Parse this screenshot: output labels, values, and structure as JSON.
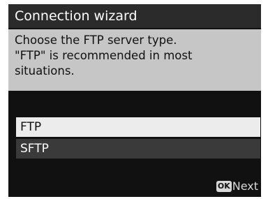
{
  "title": "Connection wizard",
  "instructions": [
    "Choose the FTP server type.",
    "\"FTP\" is recommended in most",
    "situations."
  ],
  "options": [
    {
      "label": "FTP",
      "selected": true
    },
    {
      "label": "SFTP",
      "selected": false
    }
  ],
  "footer": {
    "ok_icon_text": "OK",
    "action_label": "Next"
  },
  "colors": {
    "background": "#111111",
    "title_bar": "#2b2b2b",
    "instruction_panel": "#c6c6c6",
    "selected_option": "#ececec",
    "unselected_option": "#3a3a3a"
  },
  "icons": {
    "ok_button": "ok-button-icon"
  }
}
